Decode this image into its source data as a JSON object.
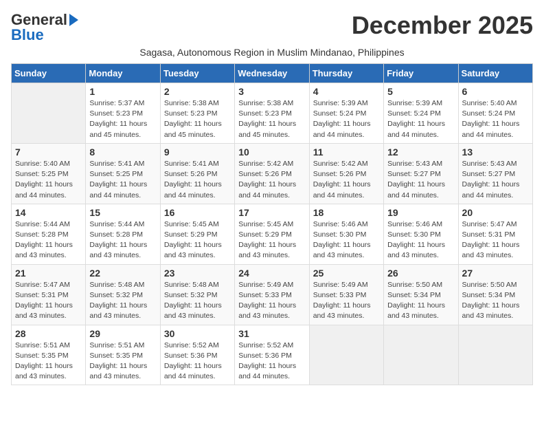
{
  "header": {
    "logo_general": "General",
    "logo_blue": "Blue",
    "month_title": "December 2025",
    "subtitle": "Sagasa, Autonomous Region in Muslim Mindanao, Philippines"
  },
  "weekdays": [
    "Sunday",
    "Monday",
    "Tuesday",
    "Wednesday",
    "Thursday",
    "Friday",
    "Saturday"
  ],
  "weeks": [
    [
      {
        "day": "",
        "info": ""
      },
      {
        "day": "1",
        "info": "Sunrise: 5:37 AM\nSunset: 5:23 PM\nDaylight: 11 hours\nand 45 minutes."
      },
      {
        "day": "2",
        "info": "Sunrise: 5:38 AM\nSunset: 5:23 PM\nDaylight: 11 hours\nand 45 minutes."
      },
      {
        "day": "3",
        "info": "Sunrise: 5:38 AM\nSunset: 5:23 PM\nDaylight: 11 hours\nand 45 minutes."
      },
      {
        "day": "4",
        "info": "Sunrise: 5:39 AM\nSunset: 5:24 PM\nDaylight: 11 hours\nand 44 minutes."
      },
      {
        "day": "5",
        "info": "Sunrise: 5:39 AM\nSunset: 5:24 PM\nDaylight: 11 hours\nand 44 minutes."
      },
      {
        "day": "6",
        "info": "Sunrise: 5:40 AM\nSunset: 5:24 PM\nDaylight: 11 hours\nand 44 minutes."
      }
    ],
    [
      {
        "day": "7",
        "info": "Sunrise: 5:40 AM\nSunset: 5:25 PM\nDaylight: 11 hours\nand 44 minutes."
      },
      {
        "day": "8",
        "info": "Sunrise: 5:41 AM\nSunset: 5:25 PM\nDaylight: 11 hours\nand 44 minutes."
      },
      {
        "day": "9",
        "info": "Sunrise: 5:41 AM\nSunset: 5:26 PM\nDaylight: 11 hours\nand 44 minutes."
      },
      {
        "day": "10",
        "info": "Sunrise: 5:42 AM\nSunset: 5:26 PM\nDaylight: 11 hours\nand 44 minutes."
      },
      {
        "day": "11",
        "info": "Sunrise: 5:42 AM\nSunset: 5:26 PM\nDaylight: 11 hours\nand 44 minutes."
      },
      {
        "day": "12",
        "info": "Sunrise: 5:43 AM\nSunset: 5:27 PM\nDaylight: 11 hours\nand 44 minutes."
      },
      {
        "day": "13",
        "info": "Sunrise: 5:43 AM\nSunset: 5:27 PM\nDaylight: 11 hours\nand 44 minutes."
      }
    ],
    [
      {
        "day": "14",
        "info": "Sunrise: 5:44 AM\nSunset: 5:28 PM\nDaylight: 11 hours\nand 43 minutes."
      },
      {
        "day": "15",
        "info": "Sunrise: 5:44 AM\nSunset: 5:28 PM\nDaylight: 11 hours\nand 43 minutes."
      },
      {
        "day": "16",
        "info": "Sunrise: 5:45 AM\nSunset: 5:29 PM\nDaylight: 11 hours\nand 43 minutes."
      },
      {
        "day": "17",
        "info": "Sunrise: 5:45 AM\nSunset: 5:29 PM\nDaylight: 11 hours\nand 43 minutes."
      },
      {
        "day": "18",
        "info": "Sunrise: 5:46 AM\nSunset: 5:30 PM\nDaylight: 11 hours\nand 43 minutes."
      },
      {
        "day": "19",
        "info": "Sunrise: 5:46 AM\nSunset: 5:30 PM\nDaylight: 11 hours\nand 43 minutes."
      },
      {
        "day": "20",
        "info": "Sunrise: 5:47 AM\nSunset: 5:31 PM\nDaylight: 11 hours\nand 43 minutes."
      }
    ],
    [
      {
        "day": "21",
        "info": "Sunrise: 5:47 AM\nSunset: 5:31 PM\nDaylight: 11 hours\nand 43 minutes."
      },
      {
        "day": "22",
        "info": "Sunrise: 5:48 AM\nSunset: 5:32 PM\nDaylight: 11 hours\nand 43 minutes."
      },
      {
        "day": "23",
        "info": "Sunrise: 5:48 AM\nSunset: 5:32 PM\nDaylight: 11 hours\nand 43 minutes."
      },
      {
        "day": "24",
        "info": "Sunrise: 5:49 AM\nSunset: 5:33 PM\nDaylight: 11 hours\nand 43 minutes."
      },
      {
        "day": "25",
        "info": "Sunrise: 5:49 AM\nSunset: 5:33 PM\nDaylight: 11 hours\nand 43 minutes."
      },
      {
        "day": "26",
        "info": "Sunrise: 5:50 AM\nSunset: 5:34 PM\nDaylight: 11 hours\nand 43 minutes."
      },
      {
        "day": "27",
        "info": "Sunrise: 5:50 AM\nSunset: 5:34 PM\nDaylight: 11 hours\nand 43 minutes."
      }
    ],
    [
      {
        "day": "28",
        "info": "Sunrise: 5:51 AM\nSunset: 5:35 PM\nDaylight: 11 hours\nand 43 minutes."
      },
      {
        "day": "29",
        "info": "Sunrise: 5:51 AM\nSunset: 5:35 PM\nDaylight: 11 hours\nand 43 minutes."
      },
      {
        "day": "30",
        "info": "Sunrise: 5:52 AM\nSunset: 5:36 PM\nDaylight: 11 hours\nand 44 minutes."
      },
      {
        "day": "31",
        "info": "Sunrise: 5:52 AM\nSunset: 5:36 PM\nDaylight: 11 hours\nand 44 minutes."
      },
      {
        "day": "",
        "info": ""
      },
      {
        "day": "",
        "info": ""
      },
      {
        "day": "",
        "info": ""
      }
    ]
  ]
}
